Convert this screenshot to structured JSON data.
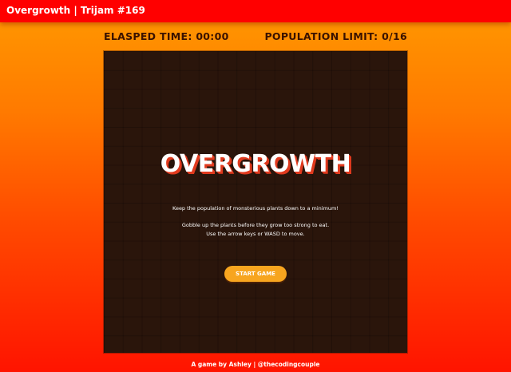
{
  "header": {
    "title": "Overgrowth | Trijam #169"
  },
  "hud": {
    "elapsed_time": "ELASPED TIME: 00:00",
    "population_limit": "POPULATION LIMIT: 0/16"
  },
  "menu": {
    "game_title": "OVERGROWTH",
    "instruction_1": "Keep the population of monsterious plants down to a minimum!",
    "instruction_2": "Gobble up the plants before they grow too strong to eat.",
    "instruction_3": "Use the arrow keys or WASD to move.",
    "start_button": "START GAME"
  },
  "footer": {
    "credit": "A game by Ashley | @thecodingcouple"
  },
  "colors": {
    "topbar": "#ff0000",
    "board": "#2a150b",
    "title_shadow": "#e03a1e",
    "start_button": "#f7a51f"
  }
}
